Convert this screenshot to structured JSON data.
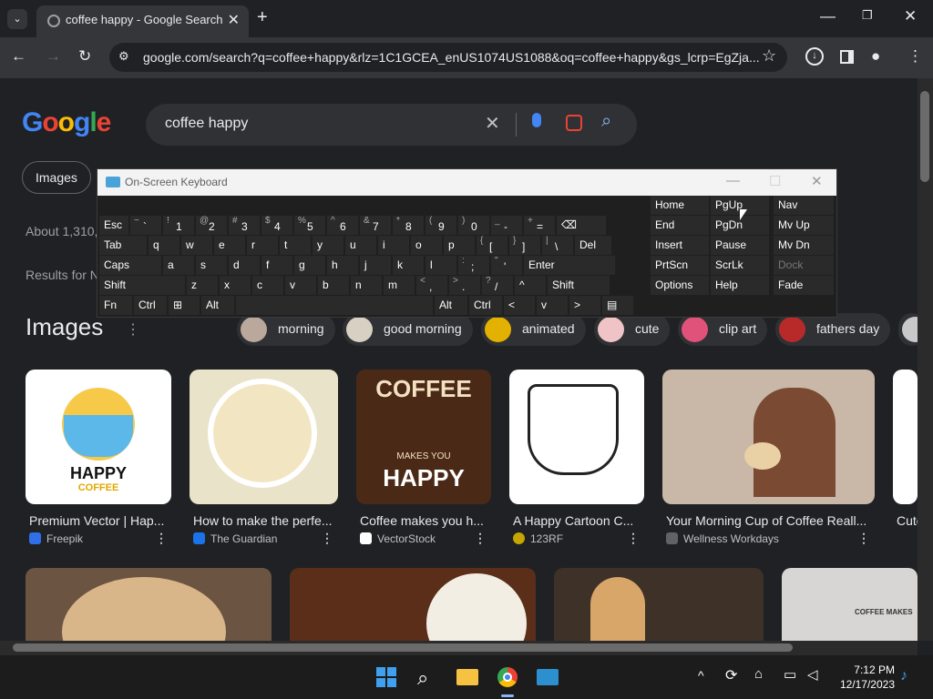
{
  "browser": {
    "tab_title": "coffee happy - Google Search",
    "new_tab": "+",
    "url": "google.com/search?q=coffee+happy&rlz=1C1GCEA_enUS1074US1088&oq=coffee+happy&gs_lcrp=EgZja..."
  },
  "search": {
    "logo": "Google",
    "query": "coffee happy",
    "tab_images": "Images",
    "about": "About 1,310,",
    "results_for": "Results for N"
  },
  "images_section": {
    "heading": "Images",
    "chips": [
      "morning",
      "good morning",
      "animated",
      "cute",
      "clip art",
      "fathers day"
    ],
    "results": [
      {
        "caption": "Premium Vector | Hap...",
        "source": "Freepik",
        "inner": "HAPPY",
        "inner2": "COFFEE"
      },
      {
        "caption": "How to make the perfe...",
        "source": "The Guardian"
      },
      {
        "caption": "Coffee makes you h...",
        "source": "VectorStock",
        "inner": "COFFEE",
        "inner2": "MAKES YOU",
        "inner3": "HAPPY"
      },
      {
        "caption": "A Happy Cartoon C...",
        "source": "123RF"
      },
      {
        "caption": "Your Morning Cup of Coffee Reall...",
        "source": "Wellness Workdays"
      },
      {
        "caption": "Cute",
        "source": ""
      }
    ],
    "row2_text": "COFFEE MAKES"
  },
  "osk": {
    "title": "On-Screen Keyboard",
    "rows": [
      [
        {
          "s": "",
          "l": "Esc"
        },
        {
          "s": "~",
          "l": "`"
        },
        {
          "s": "!",
          "l": "1"
        },
        {
          "s": "@",
          "l": "2"
        },
        {
          "s": "#",
          "l": "3"
        },
        {
          "s": "$",
          "l": "4"
        },
        {
          "s": "%",
          "l": "5"
        },
        {
          "s": "^",
          "l": "6"
        },
        {
          "s": "&",
          "l": "7"
        },
        {
          "s": "*",
          "l": "8"
        },
        {
          "s": "(",
          "l": "9"
        },
        {
          "s": ")",
          "l": "0"
        },
        {
          "s": "_",
          "l": "-"
        },
        {
          "s": "+",
          "l": "="
        },
        {
          "s": "",
          "l": "⌫"
        }
      ],
      [
        {
          "s": "",
          "l": "Tab"
        },
        {
          "s": "",
          "l": "q"
        },
        {
          "s": "",
          "l": "w"
        },
        {
          "s": "",
          "l": "e"
        },
        {
          "s": "",
          "l": "r"
        },
        {
          "s": "",
          "l": "t"
        },
        {
          "s": "",
          "l": "y"
        },
        {
          "s": "",
          "l": "u"
        },
        {
          "s": "",
          "l": "i"
        },
        {
          "s": "",
          "l": "o"
        },
        {
          "s": "",
          "l": "p"
        },
        {
          "s": "{",
          "l": "["
        },
        {
          "s": "}",
          "l": "]"
        },
        {
          "s": "|",
          "l": "\\"
        },
        {
          "s": "",
          "l": "Del"
        }
      ],
      [
        {
          "s": "",
          "l": "Caps"
        },
        {
          "s": "",
          "l": "a"
        },
        {
          "s": "",
          "l": "s"
        },
        {
          "s": "",
          "l": "d"
        },
        {
          "s": "",
          "l": "f"
        },
        {
          "s": "",
          "l": "g"
        },
        {
          "s": "",
          "l": "h"
        },
        {
          "s": "",
          "l": "j"
        },
        {
          "s": "",
          "l": "k"
        },
        {
          "s": "",
          "l": "l"
        },
        {
          "s": ":",
          "l": ";"
        },
        {
          "s": "\"",
          "l": "'"
        },
        {
          "s": "",
          "l": "Enter"
        }
      ],
      [
        {
          "s": "",
          "l": "Shift"
        },
        {
          "s": "",
          "l": "z"
        },
        {
          "s": "",
          "l": "x"
        },
        {
          "s": "",
          "l": "c"
        },
        {
          "s": "",
          "l": "v"
        },
        {
          "s": "",
          "l": "b"
        },
        {
          "s": "",
          "l": "n"
        },
        {
          "s": "",
          "l": "m"
        },
        {
          "s": "<",
          "l": ","
        },
        {
          "s": ">",
          "l": "."
        },
        {
          "s": "?",
          "l": "/"
        },
        {
          "s": "",
          "l": "^"
        },
        {
          "s": "",
          "l": "Shift"
        }
      ],
      [
        {
          "s": "",
          "l": "Fn"
        },
        {
          "s": "",
          "l": "Ctrl"
        },
        {
          "s": "",
          "l": "⊞"
        },
        {
          "s": "",
          "l": "Alt"
        },
        {
          "s": "",
          "l": ""
        },
        {
          "s": "",
          "l": "Alt"
        },
        {
          "s": "",
          "l": "Ctrl"
        },
        {
          "s": "",
          "l": "<"
        },
        {
          "s": "",
          "l": "v"
        },
        {
          "s": "",
          "l": ">"
        },
        {
          "s": "",
          "l": "▤"
        }
      ]
    ],
    "nav_keys": [
      [
        "Home",
        "PgUp",
        "Nav"
      ],
      [
        "End",
        "PgDn",
        "Mv Up"
      ],
      [
        "Insert",
        "Pause",
        "Mv Dn"
      ],
      [
        "PrtScn",
        "ScrLk",
        "Dock"
      ],
      [
        "Options",
        "Help",
        "Fade"
      ]
    ]
  },
  "taskbar": {
    "time": "7:12 PM",
    "date": "12/17/2023"
  }
}
